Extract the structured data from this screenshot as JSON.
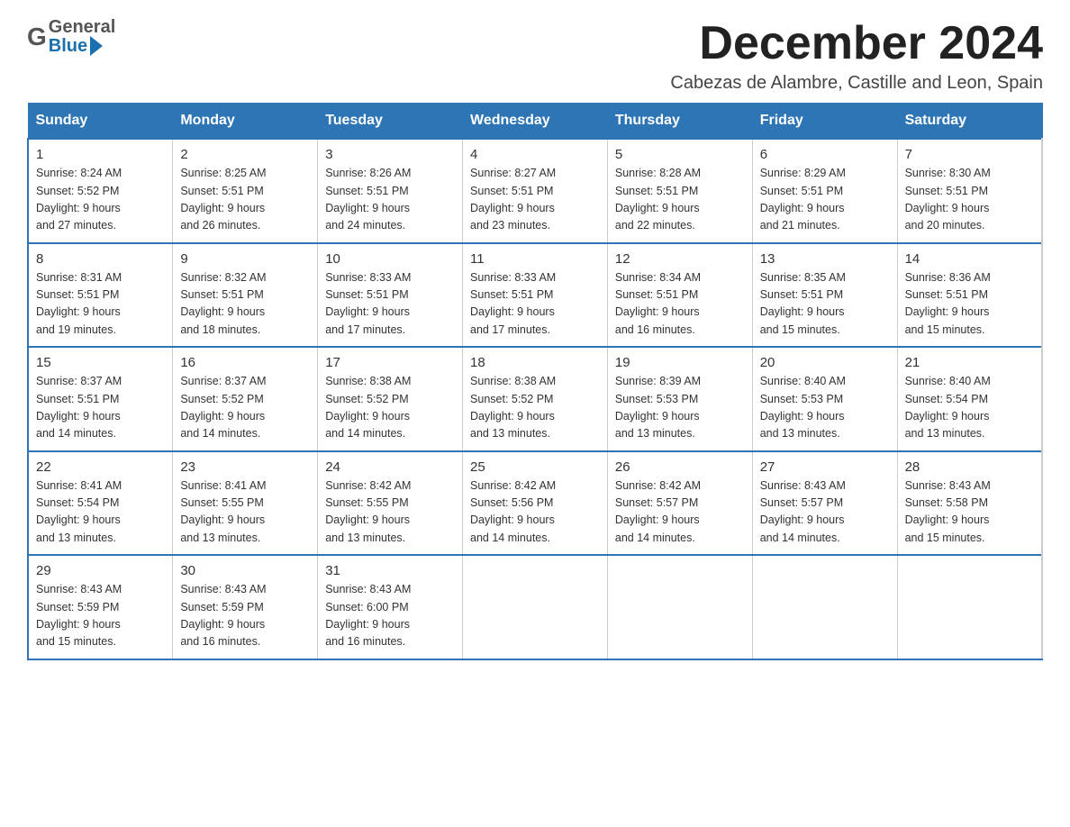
{
  "logo": {
    "general": "General",
    "blue": "Blue"
  },
  "header": {
    "title": "December 2024",
    "subtitle": "Cabezas de Alambre, Castille and Leon, Spain"
  },
  "weekdays": [
    "Sunday",
    "Monday",
    "Tuesday",
    "Wednesday",
    "Thursday",
    "Friday",
    "Saturday"
  ],
  "weeks": [
    [
      {
        "day": "1",
        "sunrise": "8:24 AM",
        "sunset": "5:52 PM",
        "daylight": "9 hours and 27 minutes."
      },
      {
        "day": "2",
        "sunrise": "8:25 AM",
        "sunset": "5:51 PM",
        "daylight": "9 hours and 26 minutes."
      },
      {
        "day": "3",
        "sunrise": "8:26 AM",
        "sunset": "5:51 PM",
        "daylight": "9 hours and 24 minutes."
      },
      {
        "day": "4",
        "sunrise": "8:27 AM",
        "sunset": "5:51 PM",
        "daylight": "9 hours and 23 minutes."
      },
      {
        "day": "5",
        "sunrise": "8:28 AM",
        "sunset": "5:51 PM",
        "daylight": "9 hours and 22 minutes."
      },
      {
        "day": "6",
        "sunrise": "8:29 AM",
        "sunset": "5:51 PM",
        "daylight": "9 hours and 21 minutes."
      },
      {
        "day": "7",
        "sunrise": "8:30 AM",
        "sunset": "5:51 PM",
        "daylight": "9 hours and 20 minutes."
      }
    ],
    [
      {
        "day": "8",
        "sunrise": "8:31 AM",
        "sunset": "5:51 PM",
        "daylight": "9 hours and 19 minutes."
      },
      {
        "day": "9",
        "sunrise": "8:32 AM",
        "sunset": "5:51 PM",
        "daylight": "9 hours and 18 minutes."
      },
      {
        "day": "10",
        "sunrise": "8:33 AM",
        "sunset": "5:51 PM",
        "daylight": "9 hours and 17 minutes."
      },
      {
        "day": "11",
        "sunrise": "8:33 AM",
        "sunset": "5:51 PM",
        "daylight": "9 hours and 17 minutes."
      },
      {
        "day": "12",
        "sunrise": "8:34 AM",
        "sunset": "5:51 PM",
        "daylight": "9 hours and 16 minutes."
      },
      {
        "day": "13",
        "sunrise": "8:35 AM",
        "sunset": "5:51 PM",
        "daylight": "9 hours and 15 minutes."
      },
      {
        "day": "14",
        "sunrise": "8:36 AM",
        "sunset": "5:51 PM",
        "daylight": "9 hours and 15 minutes."
      }
    ],
    [
      {
        "day": "15",
        "sunrise": "8:37 AM",
        "sunset": "5:51 PM",
        "daylight": "9 hours and 14 minutes."
      },
      {
        "day": "16",
        "sunrise": "8:37 AM",
        "sunset": "5:52 PM",
        "daylight": "9 hours and 14 minutes."
      },
      {
        "day": "17",
        "sunrise": "8:38 AM",
        "sunset": "5:52 PM",
        "daylight": "9 hours and 14 minutes."
      },
      {
        "day": "18",
        "sunrise": "8:38 AM",
        "sunset": "5:52 PM",
        "daylight": "9 hours and 13 minutes."
      },
      {
        "day": "19",
        "sunrise": "8:39 AM",
        "sunset": "5:53 PM",
        "daylight": "9 hours and 13 minutes."
      },
      {
        "day": "20",
        "sunrise": "8:40 AM",
        "sunset": "5:53 PM",
        "daylight": "9 hours and 13 minutes."
      },
      {
        "day": "21",
        "sunrise": "8:40 AM",
        "sunset": "5:54 PM",
        "daylight": "9 hours and 13 minutes."
      }
    ],
    [
      {
        "day": "22",
        "sunrise": "8:41 AM",
        "sunset": "5:54 PM",
        "daylight": "9 hours and 13 minutes."
      },
      {
        "day": "23",
        "sunrise": "8:41 AM",
        "sunset": "5:55 PM",
        "daylight": "9 hours and 13 minutes."
      },
      {
        "day": "24",
        "sunrise": "8:42 AM",
        "sunset": "5:55 PM",
        "daylight": "9 hours and 13 minutes."
      },
      {
        "day": "25",
        "sunrise": "8:42 AM",
        "sunset": "5:56 PM",
        "daylight": "9 hours and 14 minutes."
      },
      {
        "day": "26",
        "sunrise": "8:42 AM",
        "sunset": "5:57 PM",
        "daylight": "9 hours and 14 minutes."
      },
      {
        "day": "27",
        "sunrise": "8:43 AM",
        "sunset": "5:57 PM",
        "daylight": "9 hours and 14 minutes."
      },
      {
        "day": "28",
        "sunrise": "8:43 AM",
        "sunset": "5:58 PM",
        "daylight": "9 hours and 15 minutes."
      }
    ],
    [
      {
        "day": "29",
        "sunrise": "8:43 AM",
        "sunset": "5:59 PM",
        "daylight": "9 hours and 15 minutes."
      },
      {
        "day": "30",
        "sunrise": "8:43 AM",
        "sunset": "5:59 PM",
        "daylight": "9 hours and 16 minutes."
      },
      {
        "day": "31",
        "sunrise": "8:43 AM",
        "sunset": "6:00 PM",
        "daylight": "9 hours and 16 minutes."
      },
      null,
      null,
      null,
      null
    ]
  ],
  "labels": {
    "sunrise": "Sunrise:",
    "sunset": "Sunset:",
    "daylight": "Daylight:"
  }
}
